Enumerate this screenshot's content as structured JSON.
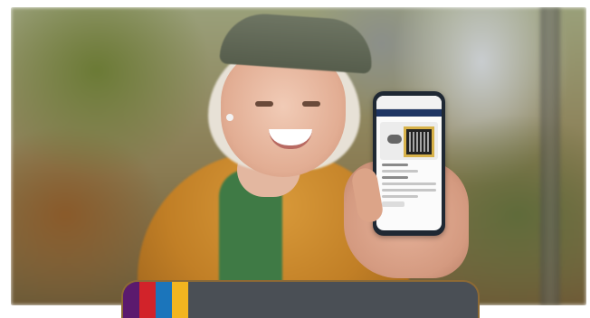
{
  "photo": {
    "subject": "smiling-woman-holding-phone",
    "colors": {
      "jacket": "#c17f26",
      "cap": "#5f6656",
      "shirt": "#3f7a45"
    }
  },
  "phone": {
    "colors": {
      "frame": "#1f2833",
      "header_bar": "#1e3563",
      "qr_border": "#d8b24a"
    }
  },
  "banner": {
    "background": "#4a4f55",
    "stripes": [
      "#5b1a6e",
      "#d2232a",
      "#1b75bb",
      "#f2b520"
    ]
  }
}
